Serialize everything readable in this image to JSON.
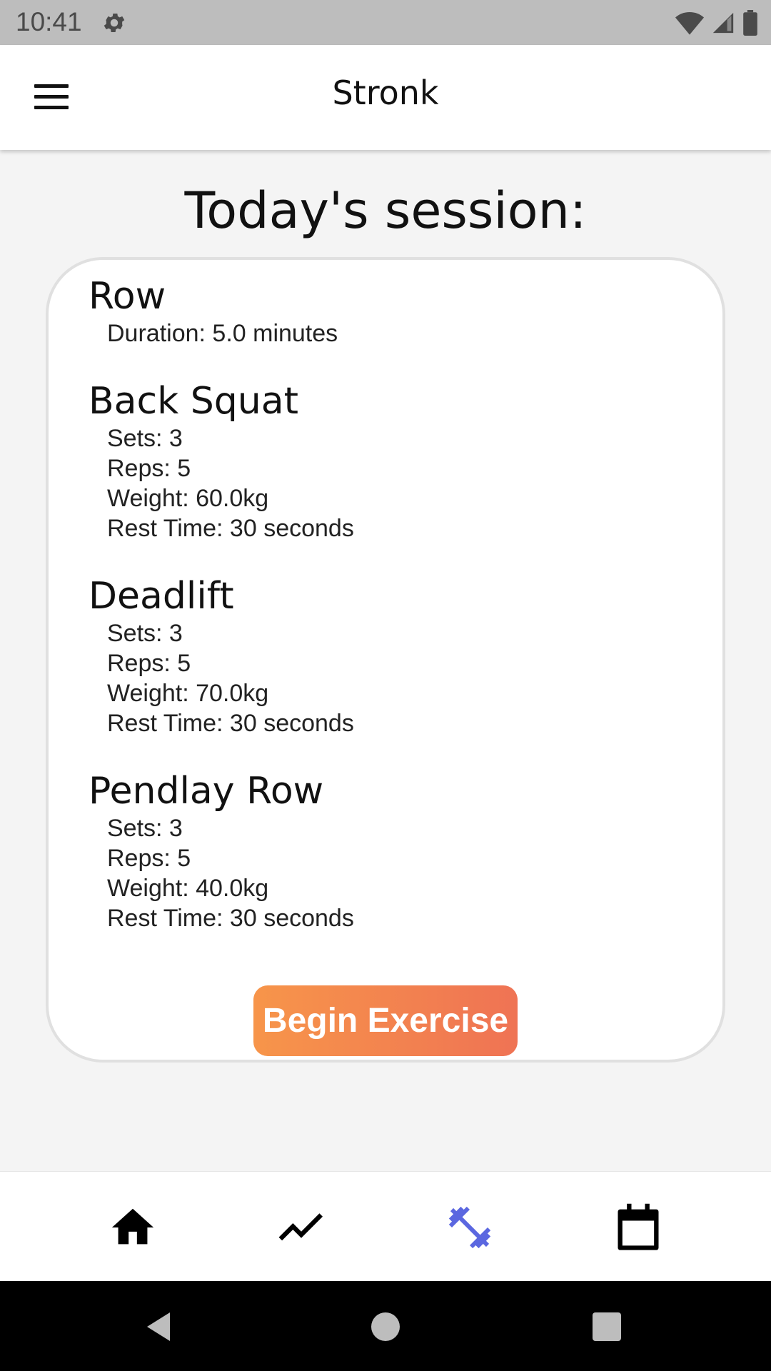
{
  "status_bar": {
    "time": "10:41",
    "icons": [
      "settings-icon",
      "wifi-icon",
      "signal-icon",
      "battery-icon"
    ]
  },
  "app_bar": {
    "title": "Stronk",
    "menu_icon": "hamburger-menu-icon"
  },
  "page_title": "Today's session:",
  "exercises": [
    {
      "name": "Row",
      "details": [
        "Duration: 5.0 minutes"
      ]
    },
    {
      "name": "Back Squat",
      "details": [
        "Sets: 3",
        "Reps: 5",
        "Weight: 60.0kg",
        "Rest Time: 30 seconds"
      ]
    },
    {
      "name": "Deadlift",
      "details": [
        "Sets: 3",
        "Reps: 5",
        "Weight: 70.0kg",
        "Rest Time: 30 seconds"
      ]
    },
    {
      "name": "Pendlay Row",
      "details": [
        "Sets: 3",
        "Reps: 5",
        "Weight: 40.0kg",
        "Rest Time: 30 seconds"
      ]
    }
  ],
  "begin_button_label": "Begin Exercise",
  "bottom_nav": {
    "items": [
      "home-icon",
      "trending-icon",
      "fitness-icon",
      "calendar-icon"
    ],
    "active": "fitness-icon",
    "active_color": "#5b67e0",
    "inactive_color": "#000000"
  },
  "system_nav": [
    "back-icon",
    "home-circle-icon",
    "recents-icon"
  ],
  "colors": {
    "button_gradient_start": "#f7954a",
    "button_gradient_end": "#ef7354",
    "background": "#f4f4f4",
    "status_bar": "#bdbdbd"
  }
}
